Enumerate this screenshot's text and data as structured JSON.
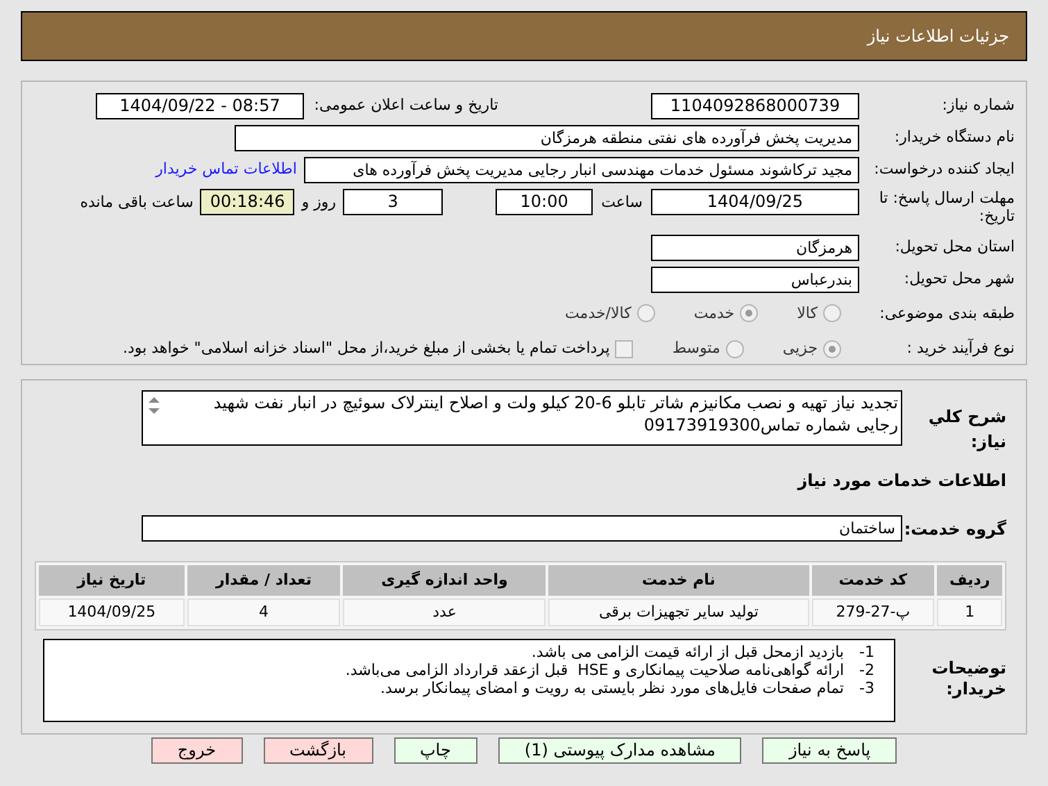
{
  "header": {
    "title": "جزئیات اطلاعات نیاز"
  },
  "fields": {
    "need_number": {
      "label": "شماره نیاز:",
      "value": "1104092868000739"
    },
    "announce": {
      "label": "تاریخ و ساعت اعلان عمومی:",
      "value": "1404/09/22 - 08:57"
    },
    "buyer": {
      "label": "نام دستگاه خریدار:",
      "value": "مدیریت پخش فرآورده های نفتی منطقه هرمزگان"
    },
    "creator": {
      "label": "ایجاد کننده درخواست:",
      "value": "مجید ترکاشوند مسئول خدمات مهندسی انبار رجایی مدیریت پخش فرآورده های",
      "link": "اطلاعات تماس خریدار"
    },
    "deadline": {
      "label": "مهلت ارسال پاسخ: تا تاریخ:",
      "date": "1404/09/25",
      "time_label": "ساعت",
      "time": "10:00",
      "days": "3",
      "days_label": "روز و",
      "remaining": "00:18:46",
      "remaining_label": "ساعت باقی مانده"
    },
    "province": {
      "label": "استان محل تحویل:",
      "value": "هرمزگان"
    },
    "city": {
      "label": "شهر محل تحویل:",
      "value": "بندرعباس"
    }
  },
  "category": {
    "label": "طبقه بندی موضوعی:",
    "options": [
      {
        "label": "کالا",
        "selected": false
      },
      {
        "label": "خدمت",
        "selected": true
      },
      {
        "label": "کالا/خدمت",
        "selected": false
      }
    ]
  },
  "purchase_type": {
    "label": "نوع فرآیند خرید :",
    "options": [
      {
        "label": "جزیی",
        "selected": true
      },
      {
        "label": "متوسط",
        "selected": false
      }
    ],
    "payment": {
      "checked": false,
      "label": "پرداخت تمام یا بخشی از مبلغ خرید،از محل \"اسناد خزانه اسلامی\" خواهد بود."
    }
  },
  "description": {
    "label": "شرح کلي نياز:",
    "value": "تجدید نیاز تهیه و نصب مکانیزم شاتر تابلو 6-20 کیلو ولت و اصلاح اینترلاک سوئیچ در انبار نفت شهید رجایی شماره تماس09173919300"
  },
  "services_heading": "اطلاعات خدمات مورد نیاز",
  "service_group": {
    "label": "گروه خدمت:",
    "value": "ساختمان"
  },
  "table": {
    "columns": [
      "ردیف",
      "کد خدمت",
      "نام خدمت",
      "واحد اندازه گیری",
      "تعداد / مقدار",
      "تاریخ نیاز"
    ],
    "rows": [
      [
        "1",
        "پ-27-279",
        "تولید سایر تجهیزات برقی",
        "عدد",
        "4",
        "1404/09/25"
      ]
    ]
  },
  "notes": {
    "label": "توضیحات خریدار:",
    "lines": [
      {
        "number": "1-",
        "text": "بازدید ازمحل قبل از ارائه قیمت الزامی می باشد."
      },
      {
        "number": "2-",
        "text": "ارائه گواهی‌نامه صلاحیت پیمانکاری و HSE  قبل ازعقد قرارداد الزامی می‌باشد."
      },
      {
        "number": "3-",
        "text": "تمام صفحات فایل‌های مورد نظر بایستی به رویت و امضای پیمانکار برسد."
      }
    ]
  },
  "buttons": [
    {
      "label": "پاسخ به نیاز",
      "kind": "action"
    },
    {
      "label": "مشاهده مدارک پیوستی (1)",
      "kind": "action"
    },
    {
      "label": "چاپ",
      "kind": "action"
    },
    {
      "label": "بازگشت",
      "kind": "danger"
    },
    {
      "label": "خروج",
      "kind": "danger"
    }
  ]
}
